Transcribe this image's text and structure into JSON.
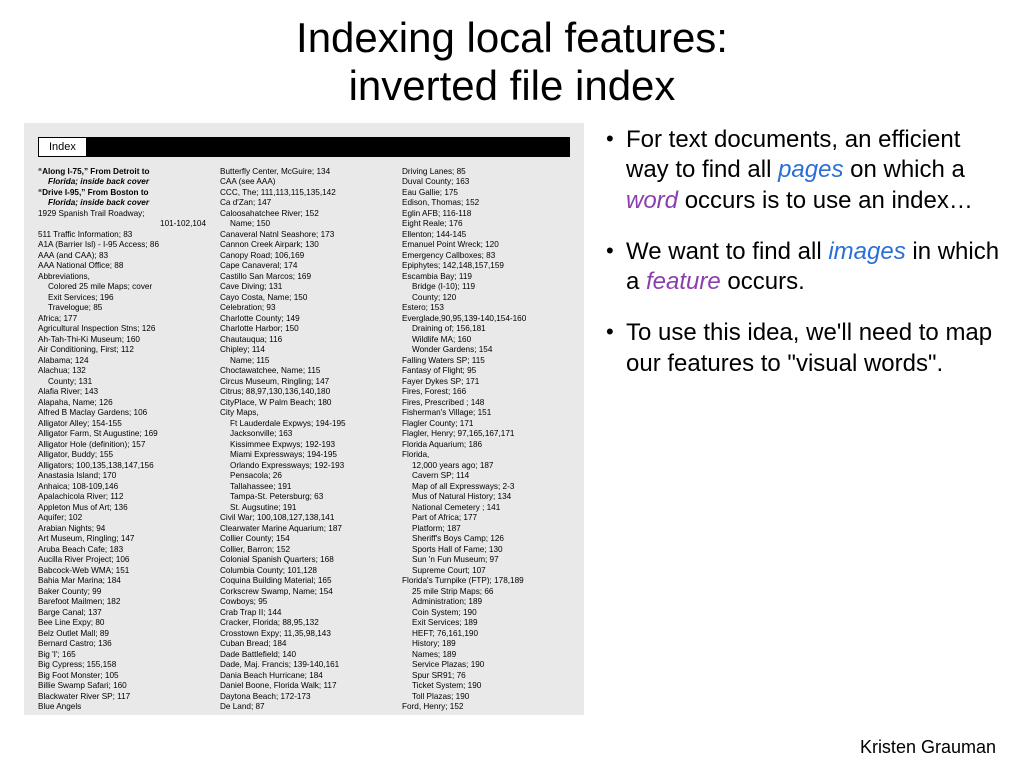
{
  "title_line1": "Indexing local features:",
  "title_line2": "inverted file index",
  "index": {
    "header_label": "Index",
    "columns": [
      [
        {
          "t": "“Along I-75,” From Detroit to",
          "cls": "boldq"
        },
        {
          "t": "Florida;  inside back cover",
          "cls": "index-sub ital"
        },
        {
          "t": "“Drive I-95,” From Boston to",
          "cls": "boldq"
        },
        {
          "t": "Florida;  inside back cover",
          "cls": "index-sub ital"
        },
        {
          "t": "1929 Spanish Trail Roadway;"
        },
        {
          "t": "101-102,104",
          "cls": "index-sub",
          "align": "right"
        },
        {
          "t": "511 Traffic Information; 83"
        },
        {
          "t": "A1A (Barrier Isl) - I-95 Access; 86"
        },
        {
          "t": "AAA (and CAA); 83"
        },
        {
          "t": "AAA National Office; 88"
        },
        {
          "t": "Abbreviations,"
        },
        {
          "t": "Colored 25 mile Maps; cover",
          "cls": "index-sub"
        },
        {
          "t": "Exit Services; 196",
          "cls": "index-sub"
        },
        {
          "t": "Travelogue; 85",
          "cls": "index-sub"
        },
        {
          "t": "Africa; 177"
        },
        {
          "t": "Agricultural Inspection Stns; 126"
        },
        {
          "t": "Ah-Tah-Thi-Ki Museum; 160"
        },
        {
          "t": "Air Conditioning, First; 112"
        },
        {
          "t": "Alabama; 124"
        },
        {
          "t": "Alachua; 132"
        },
        {
          "t": "County; 131",
          "cls": "index-sub"
        },
        {
          "t": "Alafia River; 143"
        },
        {
          "t": "Alapaha, Name; 126"
        },
        {
          "t": "Alfred B Maclay Gardens; 106"
        },
        {
          "t": "Alligator Alley; 154-155"
        },
        {
          "t": "Alligator Farm, St Augustine; 169"
        },
        {
          "t": "Alligator Hole (definition); 157"
        },
        {
          "t": "Alligator, Buddy; 155"
        },
        {
          "t": "Alligators; 100,135,138,147,156"
        },
        {
          "t": "Anastasia Island; 170"
        },
        {
          "t": "Anhaica; 108-109,146"
        },
        {
          "t": "Apalachicola River; 112"
        },
        {
          "t": "Appleton Mus of Art; 136"
        },
        {
          "t": "Aquifer; 102"
        },
        {
          "t": "Arabian Nights; 94"
        },
        {
          "t": "Art Museum, Ringling; 147"
        },
        {
          "t": "Aruba Beach Cafe; 183"
        },
        {
          "t": "Aucilla River Project; 106"
        },
        {
          "t": "Babcock-Web WMA; 151"
        },
        {
          "t": "Bahia Mar Marina; 184"
        },
        {
          "t": "Baker County; 99"
        },
        {
          "t": "Barefoot Mailmen; 182"
        },
        {
          "t": "Barge Canal; 137"
        },
        {
          "t": "Bee Line Expy; 80"
        },
        {
          "t": "Belz Outlet Mall; 89"
        },
        {
          "t": "Bernard Castro; 136"
        },
        {
          "t": "Big 'I'; 165"
        },
        {
          "t": "Big Cypress; 155,158"
        },
        {
          "t": "Big Foot Monster; 105"
        },
        {
          "t": "Billie Swamp Safari; 160"
        },
        {
          "t": "Blackwater River SP; 117"
        },
        {
          "t": "Blue Angels"
        }
      ],
      [
        {
          "t": "Butterfly Center, McGuire; 134"
        },
        {
          "t": "CAA (see AAA)"
        },
        {
          "t": "CCC, The; 111,113,115,135,142"
        },
        {
          "t": "Ca d'Zan; 147"
        },
        {
          "t": "Caloosahatchee River; 152"
        },
        {
          "t": "Name; 150",
          "cls": "index-sub"
        },
        {
          "t": "Canaveral Natnl Seashore; 173"
        },
        {
          "t": "Cannon Creek Airpark; 130"
        },
        {
          "t": "Canopy Road; 106,169"
        },
        {
          "t": "Cape Canaveral; 174"
        },
        {
          "t": "Castillo San Marcos; 169"
        },
        {
          "t": "Cave Diving; 131"
        },
        {
          "t": "Cayo Costa, Name; 150"
        },
        {
          "t": "Celebration; 93"
        },
        {
          "t": "Charlotte County; 149"
        },
        {
          "t": "Charlotte Harbor; 150"
        },
        {
          "t": "Chautauqua; 116"
        },
        {
          "t": "Chipley; 114"
        },
        {
          "t": "Name; 115",
          "cls": "index-sub"
        },
        {
          "t": "Choctawatchee, Name; 115"
        },
        {
          "t": "Circus Museum, Ringling; 147"
        },
        {
          "t": "Citrus; 88,97,130,136,140,180"
        },
        {
          "t": "CityPlace, W Palm Beach; 180"
        },
        {
          "t": "City Maps,"
        },
        {
          "t": "Ft Lauderdale Expwys; 194-195",
          "cls": "index-sub"
        },
        {
          "t": "Jacksonville; 163",
          "cls": "index-sub"
        },
        {
          "t": "Kissimmee Expwys; 192-193",
          "cls": "index-sub"
        },
        {
          "t": "Miami Expressways; 194-195",
          "cls": "index-sub"
        },
        {
          "t": "Orlando Expressways; 192-193",
          "cls": "index-sub"
        },
        {
          "t": "Pensacola; 26",
          "cls": "index-sub"
        },
        {
          "t": "Tallahassee; 191",
          "cls": "index-sub"
        },
        {
          "t": "Tampa-St. Petersburg; 63",
          "cls": "index-sub"
        },
        {
          "t": "St. Augsutine; 191",
          "cls": "index-sub"
        },
        {
          "t": "Civil War; 100,108,127,138,141"
        },
        {
          "t": "Clearwater Marine Aquarium; 187"
        },
        {
          "t": "Collier County; 154"
        },
        {
          "t": "Collier, Barron; 152"
        },
        {
          "t": "Colonial Spanish Quarters; 168"
        },
        {
          "t": "Columbia County; 101,128"
        },
        {
          "t": "Coquina Building Material; 165"
        },
        {
          "t": "Corkscrew Swamp, Name; 154"
        },
        {
          "t": "Cowboys; 95"
        },
        {
          "t": "Crab Trap II; 144"
        },
        {
          "t": "Cracker, Florida; 88,95,132"
        },
        {
          "t": "Crosstown Expy; 11,35,98,143"
        },
        {
          "t": "Cuban Bread; 184"
        },
        {
          "t": "Dade Battlefield; 140"
        },
        {
          "t": "Dade, Maj. Francis; 139-140,161"
        },
        {
          "t": "Dania Beach Hurricane; 184"
        },
        {
          "t": "Daniel Boone, Florida Walk; 117"
        },
        {
          "t": "Daytona Beach; 172-173"
        },
        {
          "t": "De Land; 87"
        }
      ],
      [
        {
          "t": "Driving Lanes; 85"
        },
        {
          "t": "Duval County; 163"
        },
        {
          "t": "Eau Gallie; 175"
        },
        {
          "t": "Edison, Thomas; 152"
        },
        {
          "t": "Eglin AFB; 116-118"
        },
        {
          "t": "Eight Reale; 176"
        },
        {
          "t": "Ellenton; 144-145"
        },
        {
          "t": "Emanuel Point Wreck; 120"
        },
        {
          "t": "Emergency Callboxes; 83"
        },
        {
          "t": "Epiphytes; 142,148,157,159"
        },
        {
          "t": "Escambia Bay; 119"
        },
        {
          "t": "Bridge (I-10); 119",
          "cls": "index-sub"
        },
        {
          "t": "County; 120",
          "cls": "index-sub"
        },
        {
          "t": "Estero; 153"
        },
        {
          "t": "Everglade,90,95,139-140,154-160"
        },
        {
          "t": "Draining of; 156,181",
          "cls": "index-sub"
        },
        {
          "t": "Wildlife MA; 160",
          "cls": "index-sub"
        },
        {
          "t": "Wonder Gardens; 154",
          "cls": "index-sub"
        },
        {
          "t": "Falling Waters SP; 115"
        },
        {
          "t": "Fantasy of Flight; 95"
        },
        {
          "t": "Fayer Dykes SP; 171"
        },
        {
          "t": "Fires, Forest; 166"
        },
        {
          "t": "Fires, Prescribed ; 148"
        },
        {
          "t": "Fisherman's Village; 151"
        },
        {
          "t": "Flagler County; 171"
        },
        {
          "t": "Flagler, Henry; 97,165,167,171"
        },
        {
          "t": "Florida Aquarium; 186"
        },
        {
          "t": "Florida,"
        },
        {
          "t": "12,000 years ago; 187",
          "cls": "index-sub"
        },
        {
          "t": "Cavern SP; 114",
          "cls": "index-sub"
        },
        {
          "t": "Map of all Expressways; 2-3",
          "cls": "index-sub"
        },
        {
          "t": "Mus of Natural History; 134",
          "cls": "index-sub"
        },
        {
          "t": "National Cemetery ; 141",
          "cls": "index-sub"
        },
        {
          "t": "Part of Africa; 177",
          "cls": "index-sub"
        },
        {
          "t": "Platform; 187",
          "cls": "index-sub"
        },
        {
          "t": "Sheriff's Boys Camp; 126",
          "cls": "index-sub"
        },
        {
          "t": "Sports Hall of Fame; 130",
          "cls": "index-sub"
        },
        {
          "t": "Sun 'n Fun Museum; 97",
          "cls": "index-sub"
        },
        {
          "t": "Supreme Court; 107",
          "cls": "index-sub"
        },
        {
          "t": "Florida's Turnpike (FTP); 178,189"
        },
        {
          "t": "25 mile Strip Maps; 66",
          "cls": "index-sub"
        },
        {
          "t": "Administration; 189",
          "cls": "index-sub"
        },
        {
          "t": "Coin System; 190",
          "cls": "index-sub"
        },
        {
          "t": "Exit Services; 189",
          "cls": "index-sub"
        },
        {
          "t": "HEFT; 76,161,190",
          "cls": "index-sub"
        },
        {
          "t": "History; 189",
          "cls": "index-sub"
        },
        {
          "t": "Names; 189",
          "cls": "index-sub"
        },
        {
          "t": "Service Plazas; 190",
          "cls": "index-sub"
        },
        {
          "t": "Spur SR91; 76",
          "cls": "index-sub"
        },
        {
          "t": "Ticket System; 190",
          "cls": "index-sub"
        },
        {
          "t": "Toll Plazas; 190",
          "cls": "index-sub"
        },
        {
          "t": "Ford, Henry; 152"
        }
      ]
    ]
  },
  "bullets": [
    {
      "parts": [
        {
          "text": "For text documents, an efficient way to find all "
        },
        {
          "text": "pages",
          "cls": "hl-blue"
        },
        {
          "text": " on which a "
        },
        {
          "text": "word",
          "cls": "hl-purple"
        },
        {
          "text": " occurs is to use an index…"
        }
      ]
    },
    {
      "parts": [
        {
          "text": "We want to find all "
        },
        {
          "text": "images",
          "cls": "hl-blue"
        },
        {
          "text": " in which a "
        },
        {
          "text": "feature",
          "cls": "hl-purple"
        },
        {
          "text": " occurs."
        }
      ]
    },
    {
      "parts": [
        {
          "text": "To use this idea, we'll need to map our features to \"visual words\"."
        }
      ]
    }
  ],
  "attribution": "Kristen Grauman"
}
